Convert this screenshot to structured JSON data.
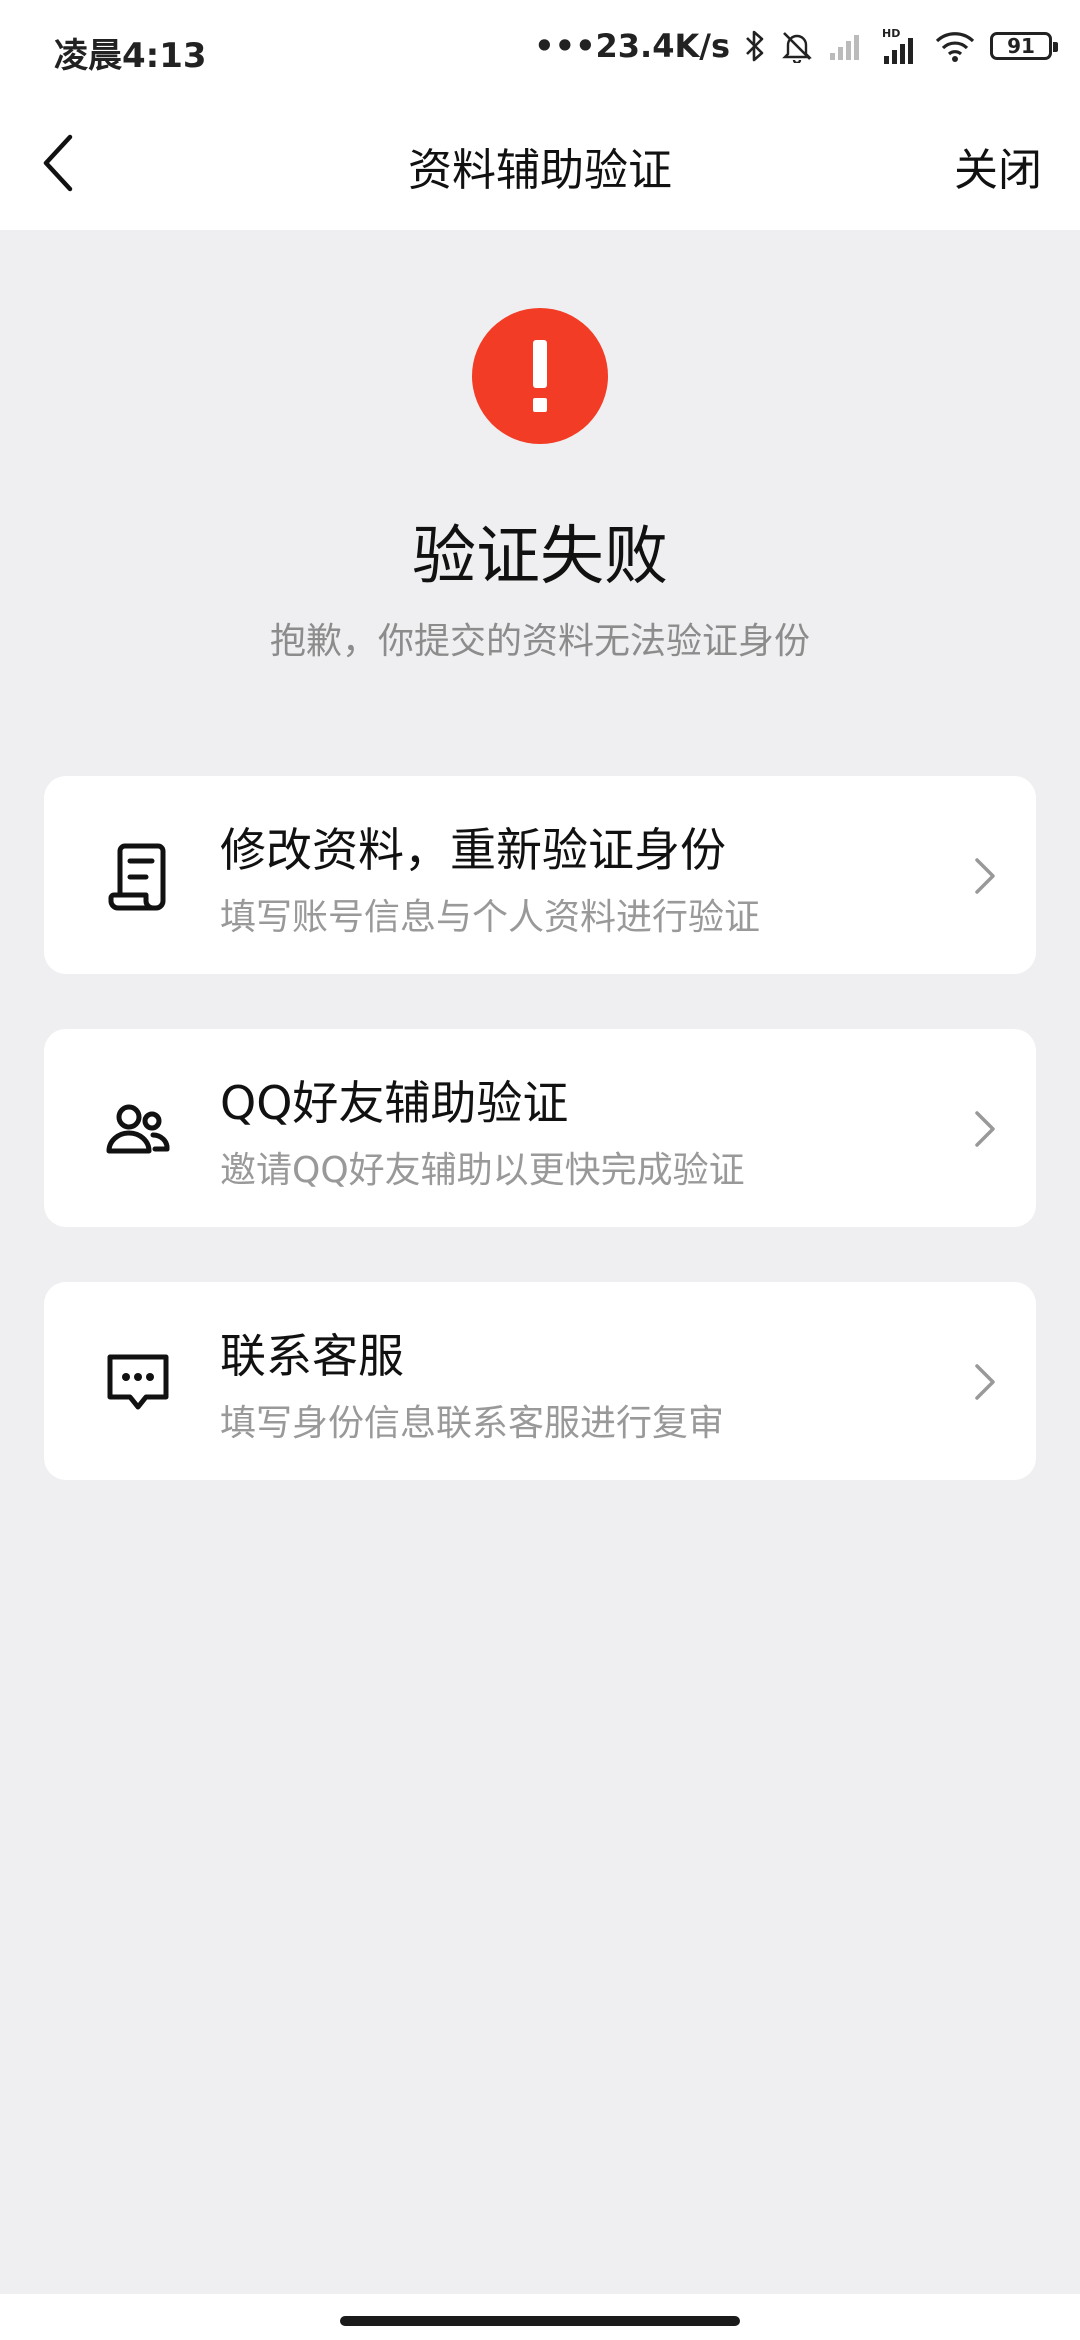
{
  "status_bar": {
    "time": "凌晨4:13",
    "network_speed": "•••23.4K/s",
    "battery_level": "91",
    "icons": [
      "bluetooth-icon",
      "mute-bell-icon",
      "signal-weak-icon",
      "signal-hd-icon",
      "wifi-icon",
      "battery-icon"
    ]
  },
  "nav": {
    "back_icon": "chevron-left-icon",
    "title": "资料辅助验证",
    "close_label": "关闭"
  },
  "result": {
    "icon": "exclamation-icon",
    "icon_color": "#f23c25",
    "title": "验证失败",
    "subtitle": "抱歉，你提交的资料无法验证身份"
  },
  "options": [
    {
      "icon": "document-icon",
      "title": "修改资料，重新验证身份",
      "subtitle": "填写账号信息与个人资料进行验证"
    },
    {
      "icon": "friends-icon",
      "title": "QQ好友辅助验证",
      "subtitle": "邀请QQ好友辅助以更快完成验证"
    },
    {
      "icon": "chat-icon",
      "title": "联系客服",
      "subtitle": "填写身份信息联系客服进行复审"
    }
  ]
}
